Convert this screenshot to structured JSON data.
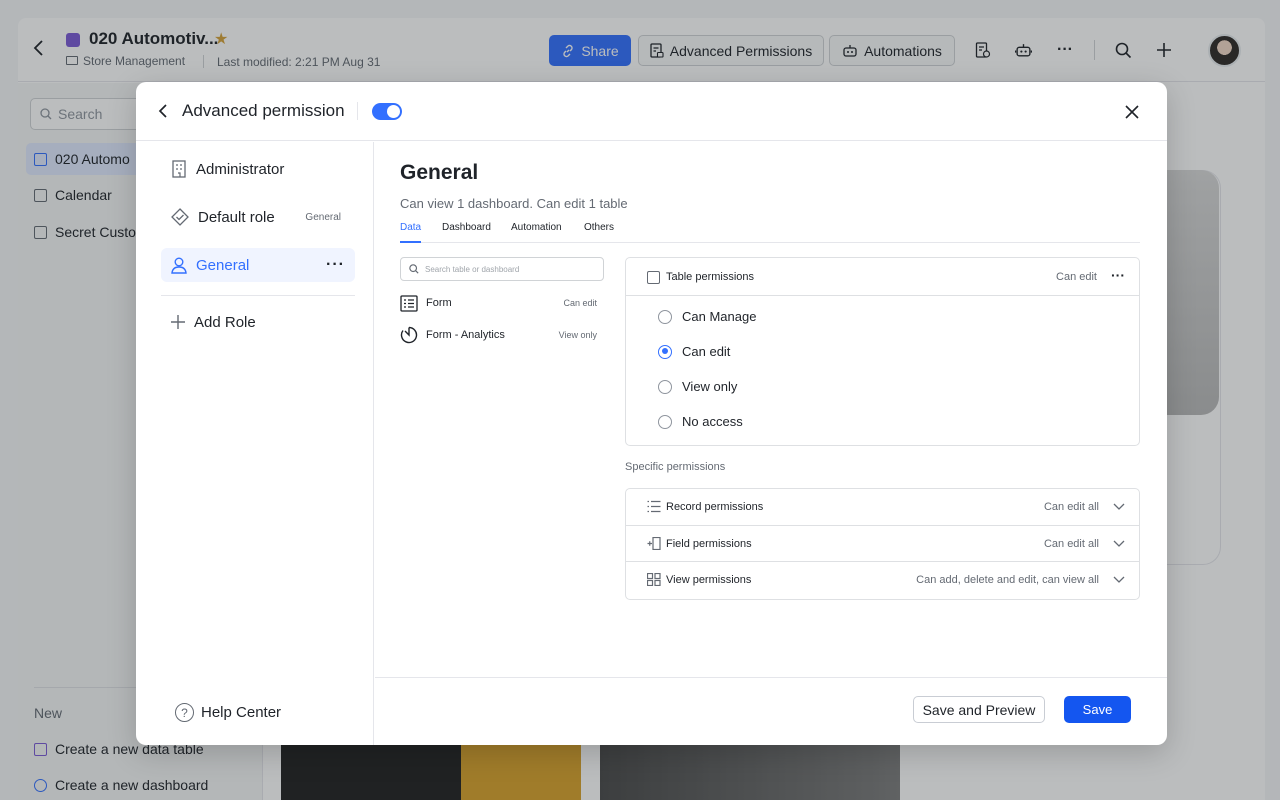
{
  "app": {
    "doc_title": "020 Automotiv...",
    "folder": "Store Management",
    "last_modified": "Last modified: 2:21 PM Aug 31",
    "share_label": "Share",
    "advanced_permissions_label": "Advanced Permissions",
    "automations_label": "Automations",
    "more_label": "···"
  },
  "sidebar": {
    "search_placeholder": "Search",
    "items": [
      {
        "label": "020 Automo",
        "icon": "table-icon"
      },
      {
        "label": "Calendar",
        "icon": "calendar-icon"
      },
      {
        "label": "Secret Custo",
        "icon": "form-icon"
      }
    ],
    "new_label": "New",
    "create_table": "Create a new data table",
    "create_dashboard": "Create a new dashboard"
  },
  "modal": {
    "title": "Advanced permission",
    "toggle_on": true,
    "roles": [
      {
        "label": "Administrator",
        "icon": "building-icon"
      },
      {
        "label": "Default role",
        "sub": "General",
        "icon": "diamond-check-icon"
      },
      {
        "label": "General",
        "icon": "user-icon",
        "more": "···"
      }
    ],
    "add_role": "Add Role",
    "help_center": "Help Center",
    "role_title": "General",
    "role_summary": "Can view 1 dashboard. Can edit 1 table",
    "tabs": [
      "Data",
      "Dashboard",
      "Automation",
      "Others"
    ],
    "search_placeholder": "Search table or dashboard",
    "tables": [
      {
        "name": "Form",
        "permission": "Can edit",
        "icon": "table-icon"
      },
      {
        "name": "Form - Analytics",
        "permission": "View only",
        "icon": "dashboard-icon"
      }
    ],
    "table_permissions": {
      "title": "Table permissions",
      "state": "Can edit",
      "more": "···",
      "options": [
        "Can Manage",
        "Can edit",
        "View only",
        "No access"
      ],
      "selected": "Can edit"
    },
    "specific_label": "Specific permissions",
    "specific": [
      {
        "title": "Record permissions",
        "value": "Can edit all",
        "icon": "list-icon"
      },
      {
        "title": "Field permissions",
        "value": "Can edit all",
        "icon": "field-add-icon"
      },
      {
        "title": "View permissions",
        "value": "Can add, delete and edit, can view all",
        "icon": "grid-icon"
      }
    ],
    "save_preview_label": "Save and Preview",
    "save_label": "Save"
  },
  "colors": {
    "accent": "#3370ff",
    "save_button": "#1456f0",
    "text": "#1f2329",
    "muted": "#646a73"
  }
}
